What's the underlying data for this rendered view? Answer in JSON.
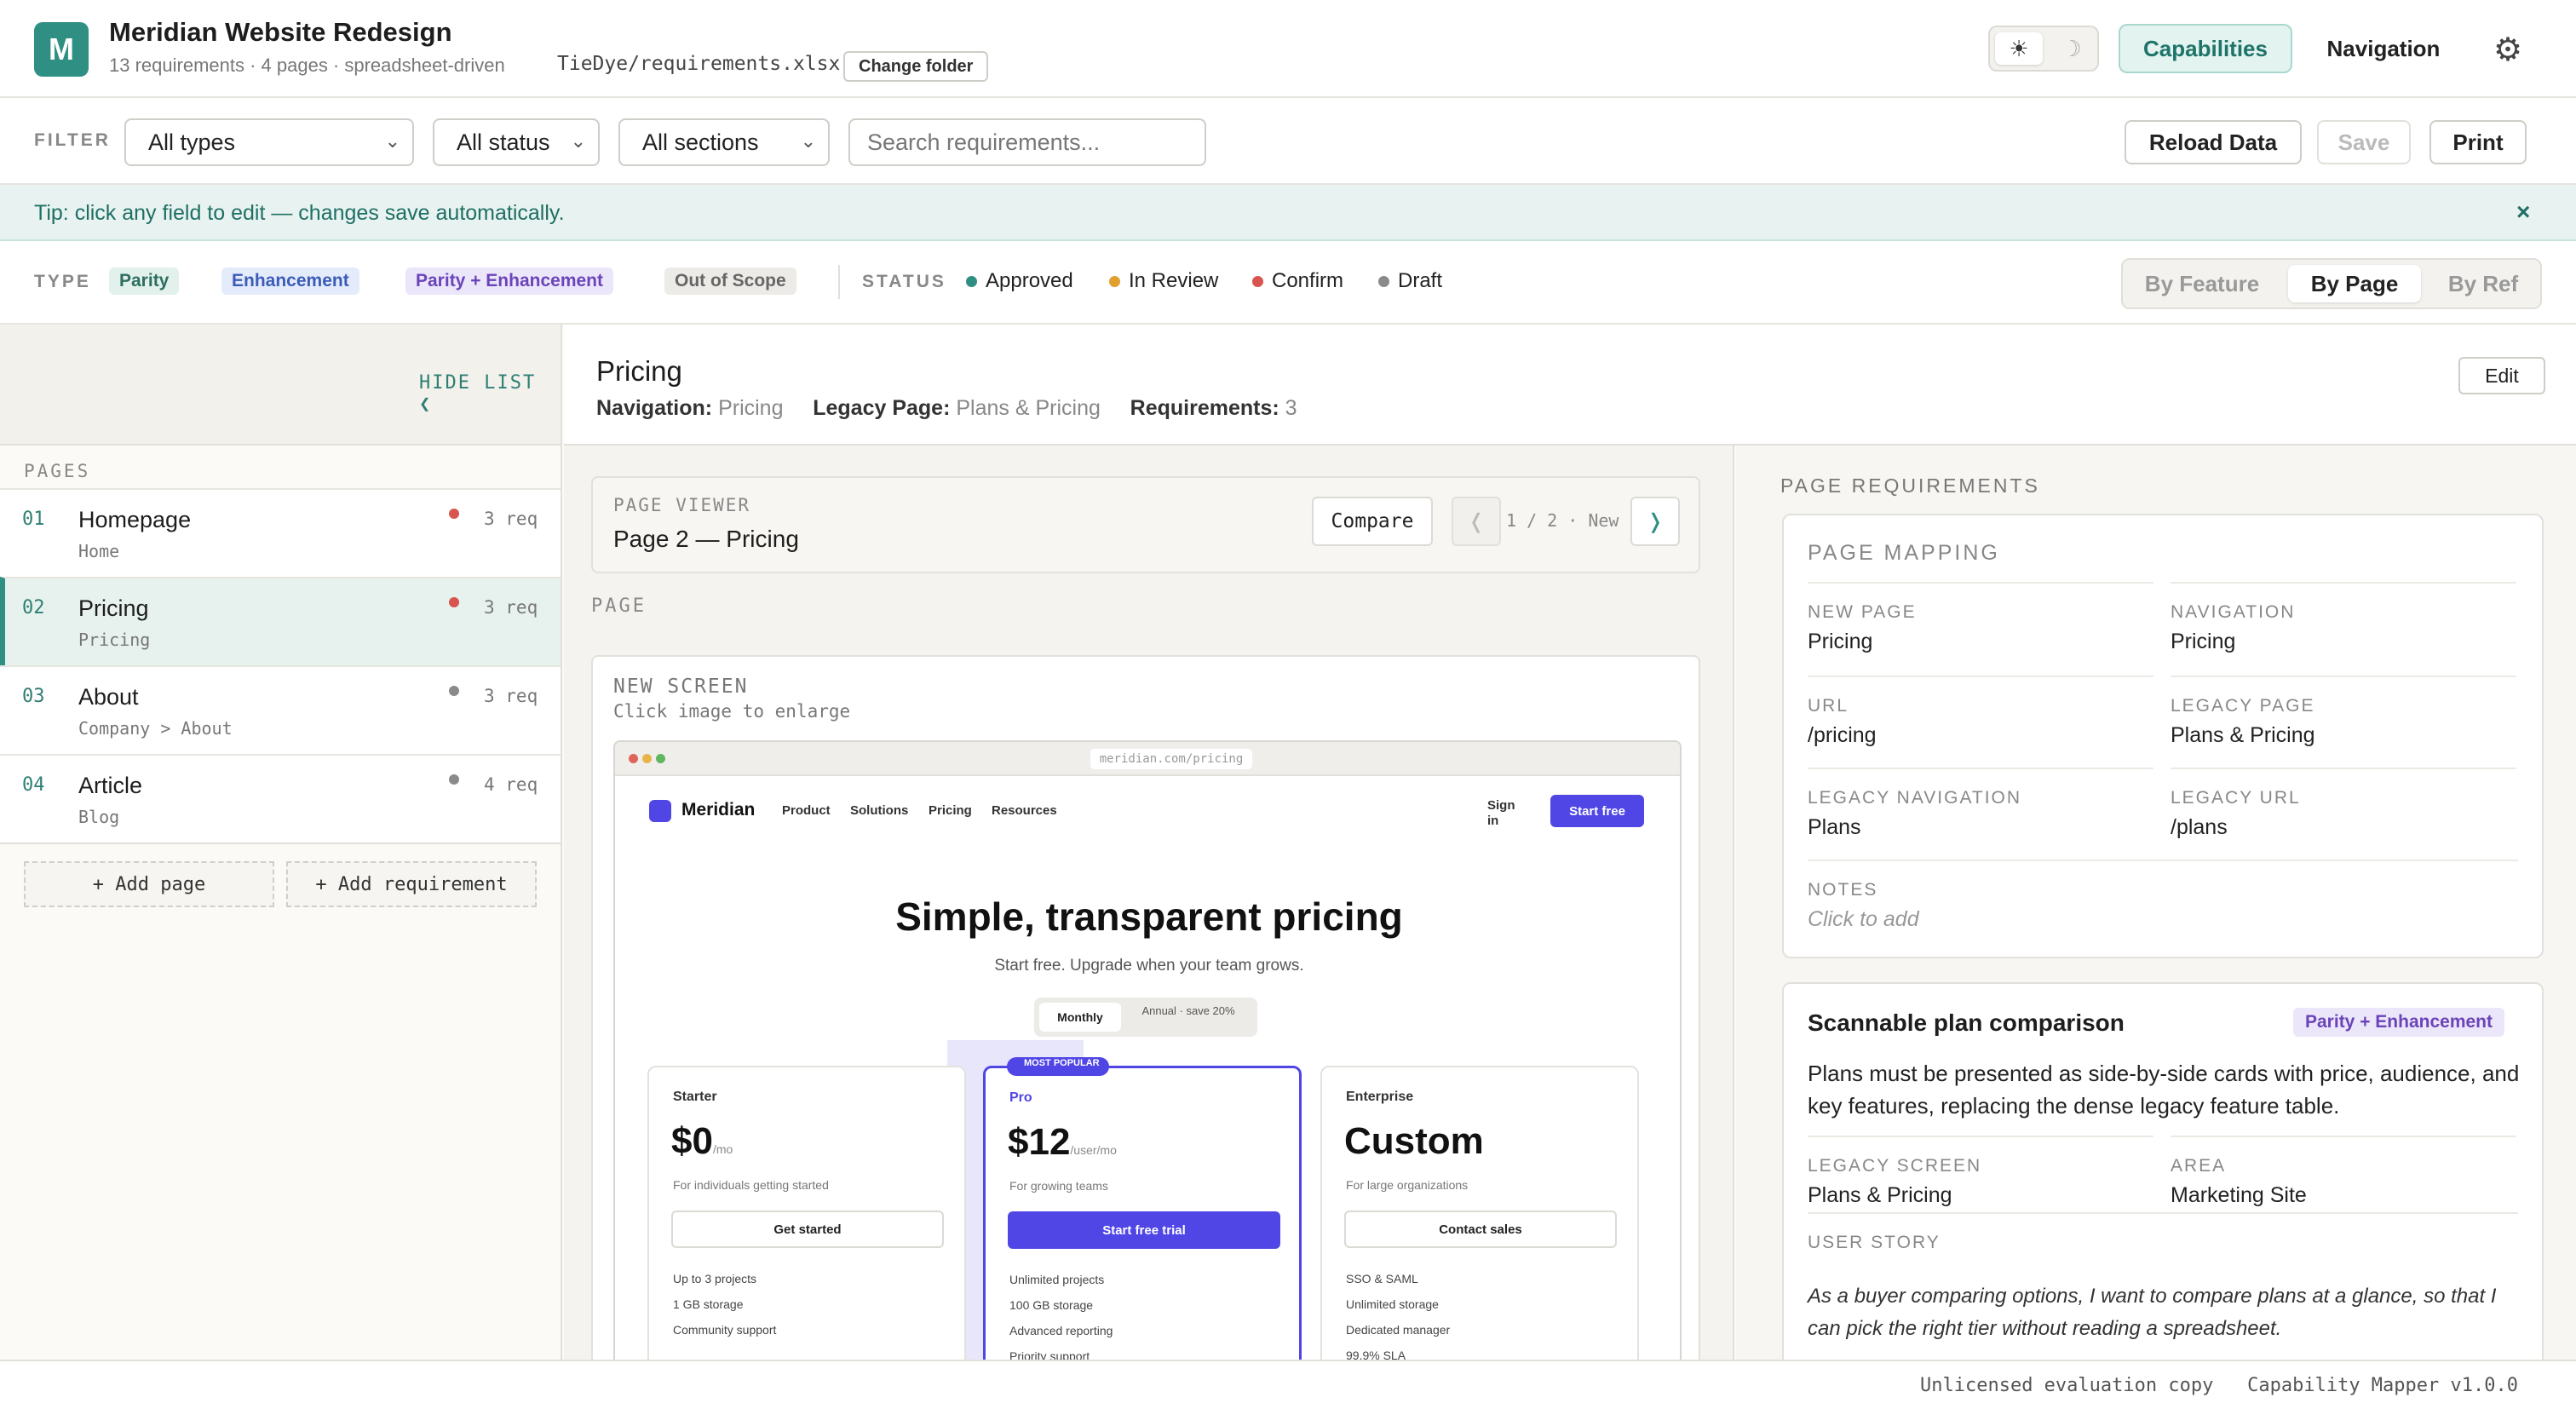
{
  "header": {
    "logo_letter": "M",
    "title": "Meridian Website Redesign",
    "meta": "13 requirements · 4 pages · spreadsheet-driven",
    "folder_path": "TieDye/requirements.xlsx",
    "change_folder_label": "Change folder",
    "theme_light_icon": "☀",
    "theme_dark_icon": "☽",
    "nav": [
      {
        "label": "Capabilities",
        "active": true
      },
      {
        "label": "Navigation",
        "active": false
      }
    ],
    "settings_icon": "⚙"
  },
  "filters": {
    "label": "FILTER",
    "type_selected": "All types",
    "status_selected": "All status",
    "section_selected": "All sections",
    "search_placeholder": "Search requirements...",
    "reload_label": "Reload Data",
    "save_label": "Save",
    "print_label": "Print"
  },
  "tip": {
    "text": "Tip: click any field to edit — changes save automatically.",
    "close": "×"
  },
  "legend": {
    "type_label": "TYPE",
    "types": [
      "Parity",
      "Enhancement",
      "Parity + Enhancement",
      "Out of Scope"
    ],
    "status_label": "STATUS",
    "statuses": [
      {
        "label": "Approved",
        "color": "#2f8f83"
      },
      {
        "label": "In Review",
        "color": "#e0a030"
      },
      {
        "label": "Confirm",
        "color": "#d9534f"
      },
      {
        "label": "Draft",
        "color": "#8a8a8a"
      }
    ],
    "views": [
      "By Feature",
      "By Page",
      "By Ref"
    ],
    "active_view": "By Page"
  },
  "sidebar": {
    "hide_list": "HIDE LIST ❮",
    "pages_label": "PAGES",
    "pages": [
      {
        "num": "01",
        "name": "Homepage",
        "sub": "Home",
        "req": "3 req",
        "dot": "#d9534f"
      },
      {
        "num": "02",
        "name": "Pricing",
        "sub": "Pricing",
        "req": "3 req",
        "dot": "#d9534f",
        "active": true
      },
      {
        "num": "03",
        "name": "About",
        "sub": "Company > About",
        "req": "3 req",
        "dot": "#8a8a8a"
      },
      {
        "num": "04",
        "name": "Article",
        "sub": "Blog",
        "req": "4 req",
        "dot": "#8a8a8a"
      }
    ],
    "add_page": "+ Add page",
    "add_requirement": "+ Add requirement"
  },
  "page": {
    "title": "Pricing",
    "nav_label": "Navigation:",
    "nav_value": "Pricing",
    "legacy_label": "Legacy Page:",
    "legacy_value": "Plans & Pricing",
    "req_label": "Requirements:",
    "req_value": "3",
    "edit_label": "Edit"
  },
  "viewer": {
    "label": "PAGE VIEWER",
    "title": "Page 2 — Pricing",
    "compare_label": "Compare",
    "prev_icon": "❬",
    "pager": "1 / 2 · New",
    "next_icon": "❭",
    "section_label": "PAGE",
    "screen_label": "NEW SCREEN",
    "screen_hint": "Click image to enlarge"
  },
  "mockup": {
    "url": "meridian.com/pricing",
    "brand": "Meridian",
    "nav": [
      "Product",
      "Solutions",
      "Pricing",
      "Resources"
    ],
    "signin": "Sign in",
    "cta": "Start free",
    "headline": "Simple, transparent pricing",
    "subhead": "Start free. Upgrade when your team grows.",
    "toggle_monthly": "Monthly",
    "toggle_annual": "Annual · save 20%",
    "badge": "MOST POPULAR",
    "plans": [
      {
        "name": "Starter",
        "price": "$0",
        "unit": "/mo",
        "desc": "For individuals getting started",
        "button": "Get started",
        "features": [
          "Up to 3 projects",
          "1 GB storage",
          "Community support"
        ]
      },
      {
        "name": "Pro",
        "price": "$12",
        "unit": "/user/mo",
        "desc": "For growing teams",
        "button": "Start free trial",
        "features": [
          "Unlimited projects",
          "100 GB storage",
          "Advanced reporting",
          "Priority support"
        ]
      },
      {
        "name": "Enterprise",
        "price": "Custom",
        "unit": "",
        "desc": "For large organizations",
        "button": "Contact sales",
        "features": [
          "SSO & SAML",
          "Unlimited storage",
          "Dedicated manager",
          "99.9% SLA"
        ]
      }
    ]
  },
  "requirements": {
    "label": "PAGE REQUIREMENTS",
    "mapping_title": "PAGE MAPPING",
    "mapping": {
      "new_page_label": "NEW PAGE",
      "new_page": "Pricing",
      "navigation_label": "NAVIGATION",
      "navigation": "Pricing",
      "url_label": "URL",
      "url": "/pricing",
      "legacy_page_label": "LEGACY PAGE",
      "legacy_page": "Plans & Pricing",
      "legacy_nav_label": "LEGACY NAVIGATION",
      "legacy_nav": "Plans",
      "legacy_url_label": "LEGACY URL",
      "legacy_url": "/plans",
      "notes_label": "NOTES",
      "notes": "Click to add"
    },
    "card": {
      "title": "Scannable plan comparison",
      "type": "Parity + Enhancement",
      "description": "Plans must be presented as side-by-side cards with price, audience, and key features, replacing the dense legacy feature table.",
      "legacy_screen_label": "LEGACY SCREEN",
      "legacy_screen": "Plans & Pricing",
      "area_label": "AREA",
      "area": "Marketing Site",
      "story_label": "USER STORY",
      "story": "As a buyer comparing options, I want to compare plans at a glance, so that I can pick the right tier without reading a spreadsheet."
    }
  },
  "footer": {
    "license": "Unlicensed evaluation copy",
    "version": "Capability Mapper v1.0.0"
  }
}
